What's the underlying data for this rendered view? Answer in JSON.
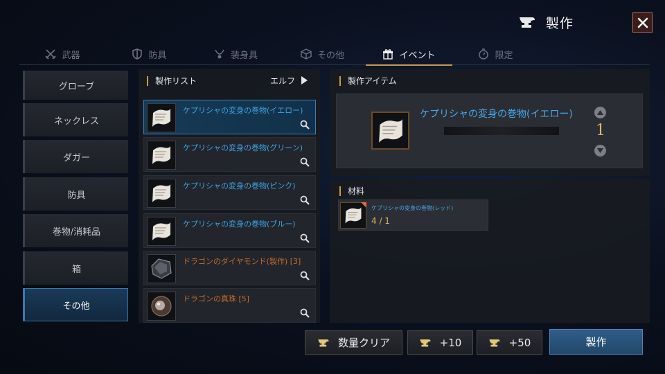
{
  "header": {
    "title": "製作",
    "anvil_icon": "anvil-icon",
    "close_icon": "close-icon"
  },
  "tabs": [
    {
      "label": "武器",
      "icon": "crossed-swords-icon",
      "active": false
    },
    {
      "label": "防具",
      "icon": "shield-icon",
      "active": false
    },
    {
      "label": "装身具",
      "icon": "necklace-icon",
      "active": false
    },
    {
      "label": "その他",
      "icon": "box-icon",
      "active": false
    },
    {
      "label": "イベント",
      "icon": "gift-icon",
      "active": true
    },
    {
      "label": "限定",
      "icon": "stopwatch-icon",
      "active": false
    }
  ],
  "categories": [
    {
      "label": "グローブ",
      "active": false
    },
    {
      "label": "ネックレス",
      "active": false
    },
    {
      "label": "ダガー",
      "active": false
    },
    {
      "label": "防具",
      "active": false
    },
    {
      "label": "巻物/消耗品",
      "active": false
    },
    {
      "label": "箱",
      "active": false
    },
    {
      "label": "その他",
      "active": true
    }
  ],
  "recipe_list": {
    "title": "製作リスト",
    "filter_label": "エルフ",
    "items": [
      {
        "name": "ケプリシャの変身の巻物(イエロー)",
        "icon": "scroll-icon",
        "active": true,
        "unavailable": false
      },
      {
        "name": "ケプリシャの変身の巻物(グリーン)",
        "icon": "scroll-icon",
        "active": false,
        "unavailable": false
      },
      {
        "name": "ケプリシャの変身の巻物(ピンク)",
        "icon": "scroll-icon",
        "active": false,
        "unavailable": false
      },
      {
        "name": "ケプリシャの変身の巻物(ブルー)",
        "icon": "scroll-icon",
        "active": false,
        "unavailable": false
      },
      {
        "name": "ドラゴンのダイヤモンド(製作) [3]",
        "icon": "diamond-icon",
        "active": false,
        "unavailable": true
      },
      {
        "name": "ドラゴンの真珠 [5]",
        "icon": "pearl-icon",
        "active": false,
        "unavailable": true
      }
    ]
  },
  "craft_item": {
    "section_title": "製作アイテム",
    "name": "ケプリシャの変身の巻物(イエロー)",
    "quantity": "1"
  },
  "materials": {
    "section_title": "材料",
    "items": [
      {
        "name": "ケプリシャの変身の巻物(レッド)",
        "count": "4 / 1",
        "icon": "scroll-icon"
      }
    ]
  },
  "buttons": {
    "clear": "数量クリア",
    "plus10": "+10",
    "plus50": "+50",
    "craft": "製作"
  },
  "colors": {
    "accent_gold": "#c89b4a",
    "item_blue": "#4aa8ea",
    "unavailable_orange": "#c36b2c",
    "count_gold": "#e2b563"
  }
}
